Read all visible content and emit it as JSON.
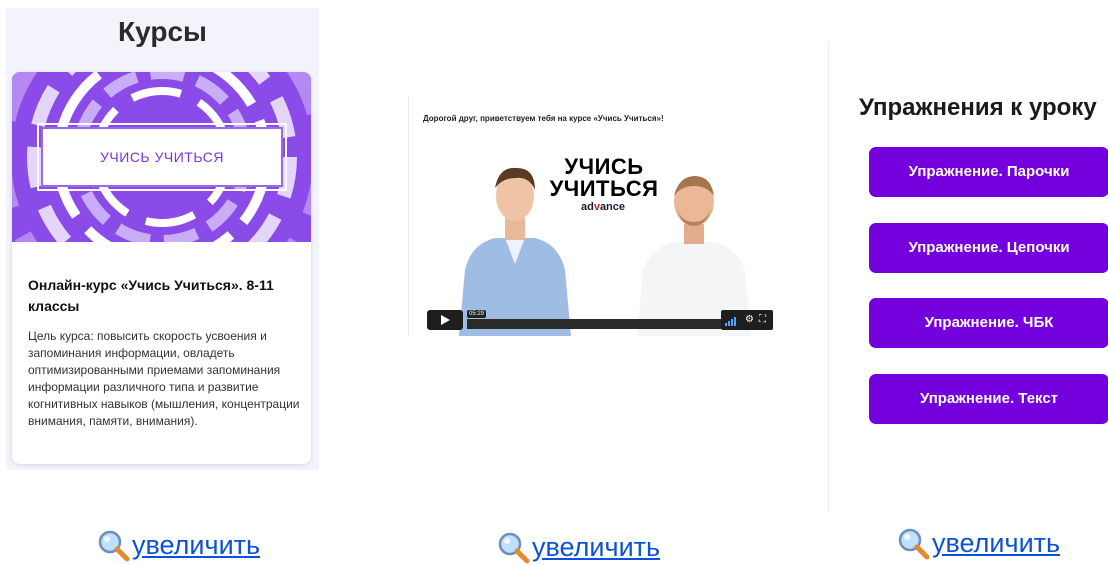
{
  "courses": {
    "title": "Курсы",
    "card": {
      "cover_label": "УЧИСЬ УЧИТЬСЯ",
      "name": "Онлайн-курс «Учись Учиться». 8-11 классы",
      "description": "Цель курса: повысить скорость усвоения и запоминания информации, овладеть оптимизированными приемами запоминания информации различного типа и развитие когнитивных навыков (мышления, концентрации внимания, памяти, внимания)."
    }
  },
  "video": {
    "greeting": "Дорогой друг, приветствуем тебя на курсе «Учись Учиться»!",
    "logo_line1": "УЧИСЬ",
    "logo_line2": "УЧИТЬСЯ",
    "brand_prefix": "ad",
    "brand_v": "v",
    "brand_suffix": "ance",
    "time": "05:29",
    "progress_fraction": 0.0
  },
  "exercises": {
    "title": "Упражнения к уроку",
    "buttons": [
      {
        "label": "Упражнение. Парочки"
      },
      {
        "label": "Упражнение. Цепочки"
      },
      {
        "label": "Упражнение. ЧБК"
      },
      {
        "label": "Упражнение. Текст"
      }
    ]
  },
  "zoom_links": [
    {
      "label": "увеличить"
    },
    {
      "label": "увеличить"
    },
    {
      "label": "увеличить"
    }
  ],
  "colors": {
    "accent": "#7400dd",
    "cover_purple": "#8a4be8",
    "link": "#0b52d8"
  },
  "icons": {
    "zoom": "magnifier-icon",
    "play": "play-icon",
    "volume": "volume-icon",
    "settings": "gear-icon",
    "fullscreen": "fullscreen-icon"
  }
}
